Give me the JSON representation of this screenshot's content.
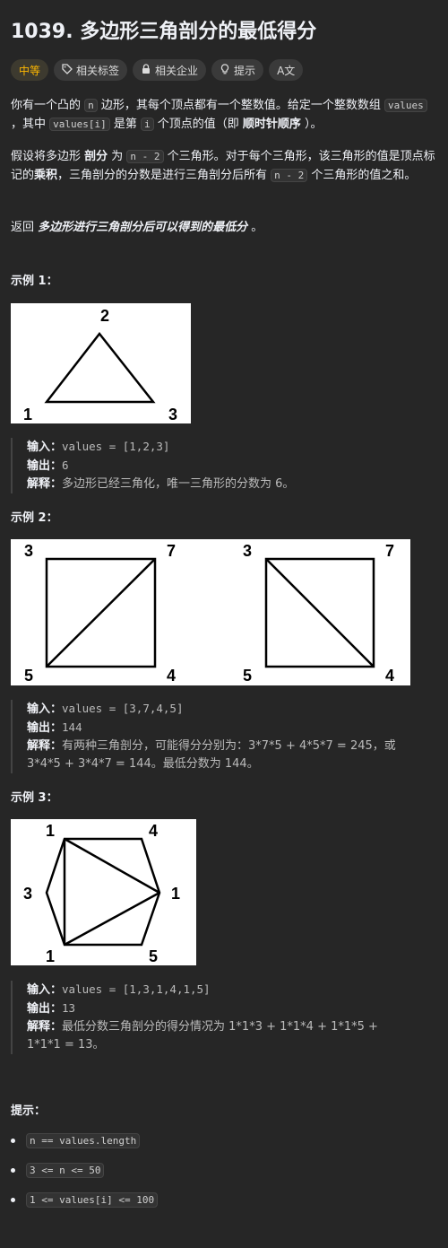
{
  "problem": {
    "title": "1039. 多边形三角剖分的最低得分",
    "difficulty": "中等",
    "tags": [
      {
        "label": "相关标签",
        "icon": "tag-icon"
      },
      {
        "label": "相关企业",
        "icon": "lock-icon"
      },
      {
        "label": "提示",
        "icon": "lightbulb-icon"
      }
    ],
    "translate_label": "A文"
  },
  "description": {
    "p1_a": "你有一个凸的 ",
    "p1_code1": "n",
    "p1_b": " 边形，其每个顶点都有一个整数值。给定一个整数数组 ",
    "p1_code2": "values",
    "p1_c": " ，其中 ",
    "p1_code3": "values[i]",
    "p1_d": " 是第 ",
    "p1_code4": "i",
    "p1_e": " 个顶点的值（即 ",
    "p1_bold": "顺时针顺序",
    "p1_f": " ）。",
    "p2_a": "假设将多边形 ",
    "p2_bold1": "剖分",
    "p2_b": " 为 ",
    "p2_code1": "n - 2",
    "p2_c": " 个三角形。对于每个三角形，该三角形的值是顶点标记的",
    "p2_bold2": "乘积",
    "p2_d": "，三角剖分的分数是进行三角剖分后所有 ",
    "p2_code2": "n - 2",
    "p2_e": " 个三角形的值之和。",
    "p3_a": "返回 ",
    "p3_italic": "多边形进行三角剖分后可以得到的最低分",
    "p3_b": " 。"
  },
  "examples": [
    {
      "heading": "示例 1：",
      "vertex_labels": [
        "2",
        "1",
        "3"
      ],
      "input_label": "输入：",
      "input": "values = [1,2,3]",
      "output_label": "输出：",
      "output": "6",
      "explain_label": "解释：",
      "explain": "多边形已经三角化，唯一三角形的分数为 6。"
    },
    {
      "heading": "示例 2：",
      "vertex_labels": [
        "3",
        "7",
        "5",
        "4",
        "3",
        "7",
        "5",
        "4"
      ],
      "input_label": "输入：",
      "input": "values = [3,7,4,5]",
      "output_label": "输出：",
      "output": "144",
      "explain_label": "解释：",
      "explain_1": "有两种三角剖分，可能得分分别为：3*7*5 + 4*5*7 = 245，或",
      "explain_2": "3*4*5 + 3*4*7 = 144。最低分数为 144。"
    },
    {
      "heading": "示例 3：",
      "vertex_labels": [
        "1",
        "4",
        "3",
        "1",
        "1",
        "5"
      ],
      "input_label": "输入：",
      "input": "values = [1,3,1,4,1,5]",
      "output_label": "输出：",
      "output": "13",
      "explain_label": "解释：",
      "explain_1": "最低分数三角剖分的得分情况为 1*1*3 + 1*1*4 + 1*1*5 +",
      "explain_2": "1*1*1 = 13。"
    }
  ],
  "constraints": {
    "heading": "提示：",
    "items": [
      "n == values.length",
      "3 <= n <= 50",
      "1 <= values[i] <= 100"
    ]
  },
  "colors": {
    "background": "#262626",
    "difficulty": "#ffb800",
    "text": "#eff1f6"
  }
}
